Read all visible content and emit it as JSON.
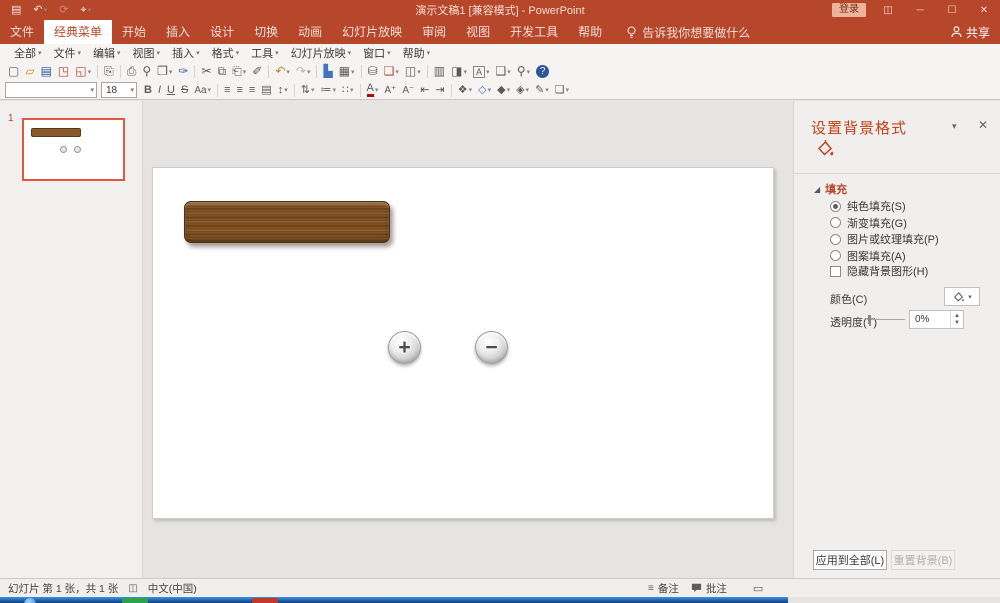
{
  "titlebar": {
    "title": "演示文稿1 [兼容模式] - PowerPoint",
    "signin_label": "登录",
    "qat_icons": [
      {
        "name": "save-icon",
        "glyph": "▤"
      },
      {
        "name": "undo-icon",
        "glyph": "↶",
        "caret": true
      },
      {
        "name": "redo-icon",
        "glyph": "⟳",
        "dim": true
      },
      {
        "name": "touch-mode-icon",
        "glyph": "⌖",
        "caret": true
      }
    ],
    "window_icons": [
      {
        "name": "ribbon-display-options-icon",
        "glyph": "◫"
      },
      {
        "name": "minimize-icon",
        "glyph": "─"
      },
      {
        "name": "maximize-icon",
        "glyph": "☐"
      },
      {
        "name": "close-icon",
        "glyph": "✕"
      }
    ]
  },
  "ribbon_tabs": {
    "items": [
      {
        "key": "file",
        "label": "文件"
      },
      {
        "key": "classic-menu",
        "label": "经典菜单",
        "active": true
      },
      {
        "key": "home",
        "label": "开始"
      },
      {
        "key": "insert",
        "label": "插入"
      },
      {
        "key": "design",
        "label": "设计"
      },
      {
        "key": "transitions",
        "label": "切换"
      },
      {
        "key": "animations",
        "label": "动画"
      },
      {
        "key": "slideshow",
        "label": "幻灯片放映"
      },
      {
        "key": "review",
        "label": "审阅"
      },
      {
        "key": "view",
        "label": "视图"
      },
      {
        "key": "developer",
        "label": "开发工具"
      },
      {
        "key": "help",
        "label": "帮助"
      }
    ],
    "tell_me": "告诉我你想要做什么",
    "share_label": "共享"
  },
  "classic_menu": {
    "items": [
      "全部",
      "文件",
      "编辑",
      "视图",
      "插入",
      "格式",
      "工具",
      "幻灯片放映",
      "窗口",
      "帮助"
    ]
  },
  "toolbar_standard": {
    "icons": [
      {
        "name": "new-file-icon",
        "glyph": "▢"
      },
      {
        "name": "open-folder-icon",
        "glyph": "▱",
        "color": "#c8922b"
      },
      {
        "name": "save-icon",
        "glyph": "▤",
        "color": "#2b579a"
      },
      {
        "name": "save-as-icon",
        "glyph": "◳",
        "color": "#b7472a"
      },
      {
        "name": "export-icon",
        "glyph": "◱",
        "color": "#b7472a",
        "caret": true
      },
      {
        "sep": true
      },
      {
        "name": "duplicate-page-icon",
        "glyph": "⎘"
      },
      {
        "sep": true
      },
      {
        "name": "print-icon",
        "glyph": "⎙"
      },
      {
        "name": "print-preview-icon",
        "glyph": "⚲"
      },
      {
        "name": "page-setup-icon",
        "glyph": "❐",
        "caret": true
      },
      {
        "name": "spelling-icon",
        "glyph": "✑",
        "color": "#2b579a"
      },
      {
        "sep": true
      },
      {
        "name": "cut-icon",
        "glyph": "✂"
      },
      {
        "name": "copy-icon",
        "glyph": "⧉"
      },
      {
        "name": "paste-icon",
        "glyph": "⎗",
        "caret": true
      },
      {
        "name": "format-painter-icon",
        "glyph": "✐"
      },
      {
        "sep": true
      },
      {
        "name": "undo-icon",
        "glyph": "↶",
        "color": "#c87f2f",
        "caret": true
      },
      {
        "name": "redo-icon",
        "glyph": "↷",
        "dim": true,
        "caret": true
      },
      {
        "sep": true
      },
      {
        "name": "chart-icon",
        "glyph": "▙",
        "color": "#4472c4"
      },
      {
        "name": "table-icon",
        "glyph": "▦",
        "caret": true
      },
      {
        "sep": true
      },
      {
        "name": "media-icon",
        "glyph": "⛁"
      },
      {
        "name": "new-slide-icon",
        "glyph": "❏",
        "color": "#b7472a",
        "caret": true
      },
      {
        "name": "layout-icon",
        "glyph": "◫",
        "caret": true
      },
      {
        "sep": true
      },
      {
        "name": "outline-view-icon",
        "glyph": "▥"
      },
      {
        "name": "slide-view-icon",
        "glyph": "◨",
        "caret": true
      },
      {
        "name": "text-box-icon",
        "glyph": "A",
        "boxed": true,
        "caret": true
      },
      {
        "name": "callout-icon",
        "glyph": "❑",
        "caret": true
      },
      {
        "name": "zoom-icon",
        "glyph": "⚲",
        "caret": true
      },
      {
        "name": "help-icon",
        "glyph": "?",
        "help": true
      }
    ]
  },
  "toolbar_formatting": {
    "font_name": "",
    "font_size": "18",
    "icons": [
      {
        "name": "bold-icon",
        "glyph": "B",
        "cls": "b"
      },
      {
        "name": "italic-icon",
        "glyph": "I",
        "cls": "i"
      },
      {
        "name": "underline-icon",
        "glyph": "U",
        "cls": "u"
      },
      {
        "name": "strikethrough-icon",
        "glyph": "S",
        "cls": "s"
      },
      {
        "name": "change-case-icon",
        "glyph": "Aa",
        "cls": "small",
        "caret": true
      },
      {
        "sep": true
      },
      {
        "name": "align-left-icon",
        "glyph": "≡"
      },
      {
        "name": "align-center-icon",
        "glyph": "≡"
      },
      {
        "name": "align-right-icon",
        "glyph": "≡"
      },
      {
        "name": "justify-icon",
        "glyph": "▤"
      },
      {
        "name": "line-spacing-icon",
        "glyph": "↕",
        "caret": true
      },
      {
        "sep": true
      },
      {
        "name": "text-direction-icon",
        "glyph": "⇅",
        "caret": true
      },
      {
        "name": "numbering-icon",
        "glyph": "≔",
        "caret": true
      },
      {
        "name": "bullets-icon",
        "glyph": "∷",
        "caret": true
      },
      {
        "sep": true
      },
      {
        "name": "font-color-icon",
        "glyph": "A",
        "cls": "fc",
        "caret": true
      },
      {
        "name": "grow-font-icon",
        "glyph": "A⁺",
        "cls": "small"
      },
      {
        "name": "shrink-font-icon",
        "glyph": "A⁻",
        "cls": "small"
      },
      {
        "name": "decrease-indent-icon",
        "glyph": "⇤"
      },
      {
        "name": "increase-indent-icon",
        "glyph": "⇥"
      },
      {
        "sep": true
      },
      {
        "name": "design-theme-icon",
        "glyph": "❖",
        "caret": true
      },
      {
        "name": "shapes-icon",
        "glyph": "◇",
        "color": "#4472c4",
        "caret": true
      },
      {
        "name": "shape-fill-icon",
        "glyph": "◆",
        "caret": true
      },
      {
        "name": "fill-bucket-icon",
        "glyph": "◈",
        "caret": true
      },
      {
        "name": "shape-outline-icon",
        "glyph": "✎",
        "caret": true
      },
      {
        "name": "shape-effects-icon",
        "glyph": "❏",
        "caret": true
      }
    ]
  },
  "slide_pane": {
    "slide_number": "1"
  },
  "slide": {
    "plus_button_glyph": "+",
    "minus_button_glyph": "−"
  },
  "task_pane": {
    "title": "设置背景格式",
    "fill_section_label": "填充",
    "fill_options": [
      {
        "label": "纯色填充(S)",
        "selected": true
      },
      {
        "label": "渐变填充(G)",
        "selected": false
      },
      {
        "label": "图片或纹理填充(P)",
        "selected": false
      },
      {
        "label": "图案填充(A)",
        "selected": false
      }
    ],
    "hide_bg_label": "隐藏背景图形(H)",
    "color_label": "颜色(C)",
    "transparency_label": "透明度(T)",
    "transparency_value": "0%",
    "apply_all_label": "应用到全部(L)",
    "reset_label": "重置背景(B)"
  },
  "status_bar": {
    "slide_counter": "幻灯片 第 1 张，共 1 张",
    "language": "中文(中国)",
    "notes_label": "备注",
    "comments_label": "批注"
  },
  "colors": {
    "accent": "#b7472a",
    "active_tab_text": "#b7472a",
    "wood_base": "#8a5a2c",
    "thumb_border": "#e0593d"
  }
}
